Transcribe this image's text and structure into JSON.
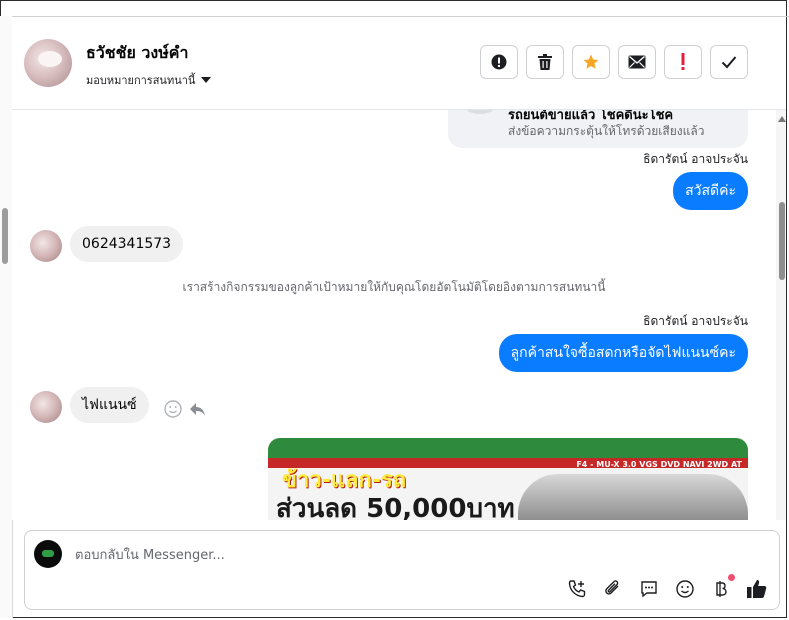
{
  "header": {
    "contact_name": "ธวัชชัย วงษ์คำ",
    "assign_label": "มอบหมายการสนทนานี้",
    "actions": [
      {
        "name": "alert-icon-button",
        "icon": "exclamation-circle-icon"
      },
      {
        "name": "delete-button",
        "icon": "trash-icon"
      },
      {
        "name": "star-button",
        "icon": "star-icon",
        "color": "#f5a623"
      },
      {
        "name": "mail-button",
        "icon": "envelope-icon"
      },
      {
        "name": "spam-button",
        "icon": "exclamation-icon",
        "color": "#e41e3f"
      },
      {
        "name": "done-button",
        "icon": "check-icon"
      }
    ]
  },
  "chat": {
    "card": {
      "title": "รถยนต์ขายแล้ว โชคดีนะโชค",
      "subtitle": "ส่งข้อความกระตุ้นให้โทรด้วยเสียงแล้ว"
    },
    "messages": [
      {
        "direction": "out",
        "sender": "ธิดารัตน์ อาจประจัน",
        "text": "สวัสดีค่ะ"
      },
      {
        "direction": "in",
        "text": "0624341573"
      },
      {
        "direction": "system",
        "text": "เราสร้างกิจกรรมของลูกค้าเป้าหมายให้กับคุณโดยอัตโนมัติโดยอิงตามการสนทนานี้"
      },
      {
        "direction": "out",
        "sender": "ธิดารัตน์ อาจประจัน",
        "text": "ลูกค้าสนใจซื้อสดกหรือจัดไฟแนนซ์คะ"
      },
      {
        "direction": "in",
        "text": "ไฟแนนซ์"
      }
    ],
    "promo": {
      "band_text": "F4 - MU-X 3.0 VGS DVD NAVI 2WD AT",
      "headline": "ข้าว-แลก-รถ",
      "discount": "ส่วนลด 50,000บาท"
    }
  },
  "composer": {
    "placeholder": "ตอบกลับใน Messenger...",
    "tools": [
      "phone-plus-icon",
      "paperclip-icon",
      "chat-bubble-icon",
      "smiley-icon",
      "baht-icon",
      "thumbs-up-icon"
    ]
  },
  "colors": {
    "accent": "#0a7cff",
    "incoming_bubble": "#f0f0f0",
    "star": "#f5a623",
    "spam": "#e41e3f"
  }
}
